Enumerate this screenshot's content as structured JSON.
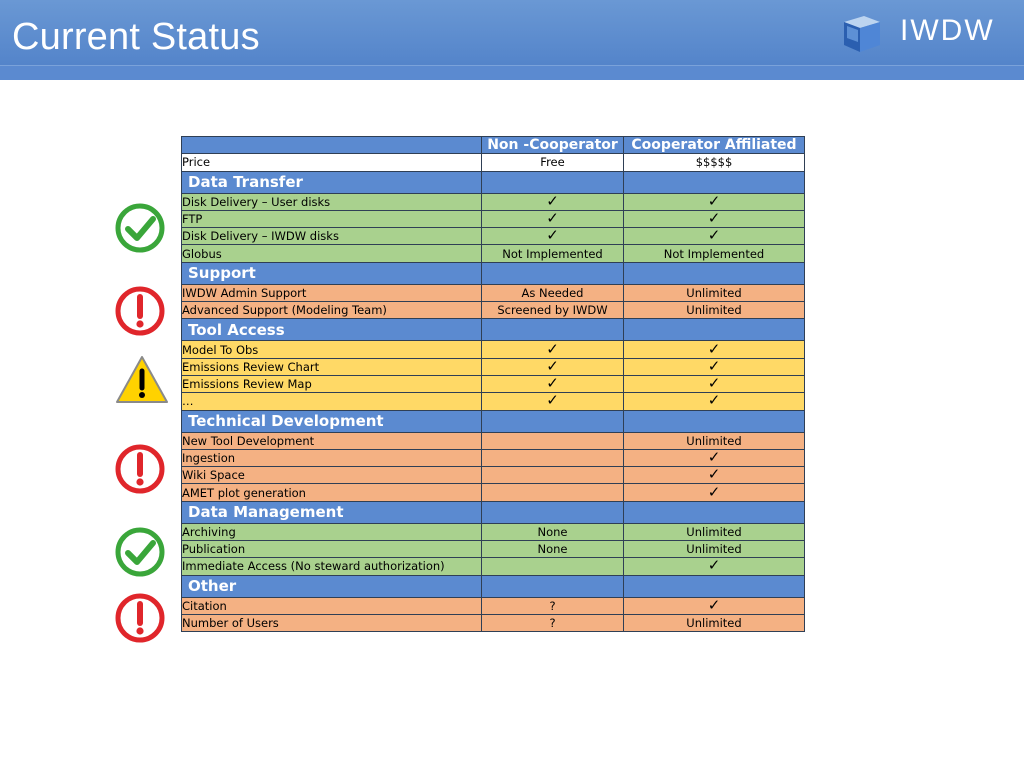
{
  "header": {
    "title": "Current Status",
    "logo_text": "IWDW"
  },
  "table": {
    "columns": [
      "",
      "Non -Cooperator",
      "Cooperator Affiliated"
    ],
    "price": {
      "label": "Price",
      "non": "Free",
      "coop": "$$$$$"
    },
    "check_glyph": "✓",
    "sections": [
      {
        "name": "Data Transfer",
        "color": "#a9d18e",
        "status": "check",
        "rows": [
          {
            "label": "Disk Delivery – User disks",
            "non": "✓",
            "coop": "✓"
          },
          {
            "label": "FTP",
            "non": "✓",
            "coop": "✓"
          },
          {
            "label": "Disk Delivery – IWDW disks",
            "non": "✓",
            "coop": "✓"
          },
          {
            "label": "Globus",
            "non": "Not Implemented",
            "coop": "Not Implemented"
          }
        ]
      },
      {
        "name": "Support",
        "color": "#f4b183",
        "status": "exclamation",
        "rows": [
          {
            "label": "IWDW Admin Support",
            "non": "As Needed",
            "coop": "Unlimited"
          },
          {
            "label": "Advanced Support (Modeling Team)",
            "non": "Screened by IWDW",
            "coop": "Unlimited"
          }
        ]
      },
      {
        "name": "Tool Access",
        "color": "#ffd966",
        "status": "warning",
        "rows": [
          {
            "label": "Model To Obs",
            "non": "✓",
            "coop": "✓"
          },
          {
            "label": "Emissions Review Chart",
            "non": "✓",
            "coop": "✓"
          },
          {
            "label": "Emissions Review Map",
            "non": "✓",
            "coop": "✓"
          },
          {
            "label": "…",
            "non": "✓",
            "coop": "✓"
          }
        ]
      },
      {
        "name": "Technical Development",
        "color": "#f4b183",
        "status": "exclamation",
        "rows": [
          {
            "label": "New Tool Development",
            "non": "",
            "coop": "Unlimited"
          },
          {
            "label": "Ingestion",
            "non": "",
            "coop": "✓"
          },
          {
            "label": "Wiki Space",
            "non": "",
            "coop": "✓"
          },
          {
            "label": "AMET plot generation",
            "non": "",
            "coop": "✓"
          }
        ]
      },
      {
        "name": "Data Management",
        "color": "#a9d18e",
        "status": "check",
        "rows": [
          {
            "label": "Archiving",
            "non": "None",
            "coop": "Unlimited"
          },
          {
            "label": "Publication",
            "non": "None",
            "coop": "Unlimited"
          },
          {
            "label": "Immediate Access (No steward authorization)",
            "non": "",
            "coop": "✓"
          }
        ]
      },
      {
        "name": "Other",
        "color": "#f4b183",
        "status": "exclamation",
        "rows": [
          {
            "label": "Citation",
            "non": "?",
            "coop": "✓"
          },
          {
            "label": "Number of Users",
            "non": "?",
            "coop": "Unlimited"
          }
        ]
      }
    ]
  },
  "colors": {
    "header_blue": "#5b8ad0",
    "green": "#a9d18e",
    "orange": "#f4b183",
    "yellow": "#ffd966",
    "icon_green": "#3aa63a",
    "icon_red": "#e0262b",
    "icon_yellow": "#ffd200"
  },
  "status_icons": [
    "check-circle-icon",
    "exclamation-circle-icon",
    "warning-triangle-icon",
    "exclamation-circle-icon",
    "check-circle-icon",
    "exclamation-circle-icon"
  ]
}
